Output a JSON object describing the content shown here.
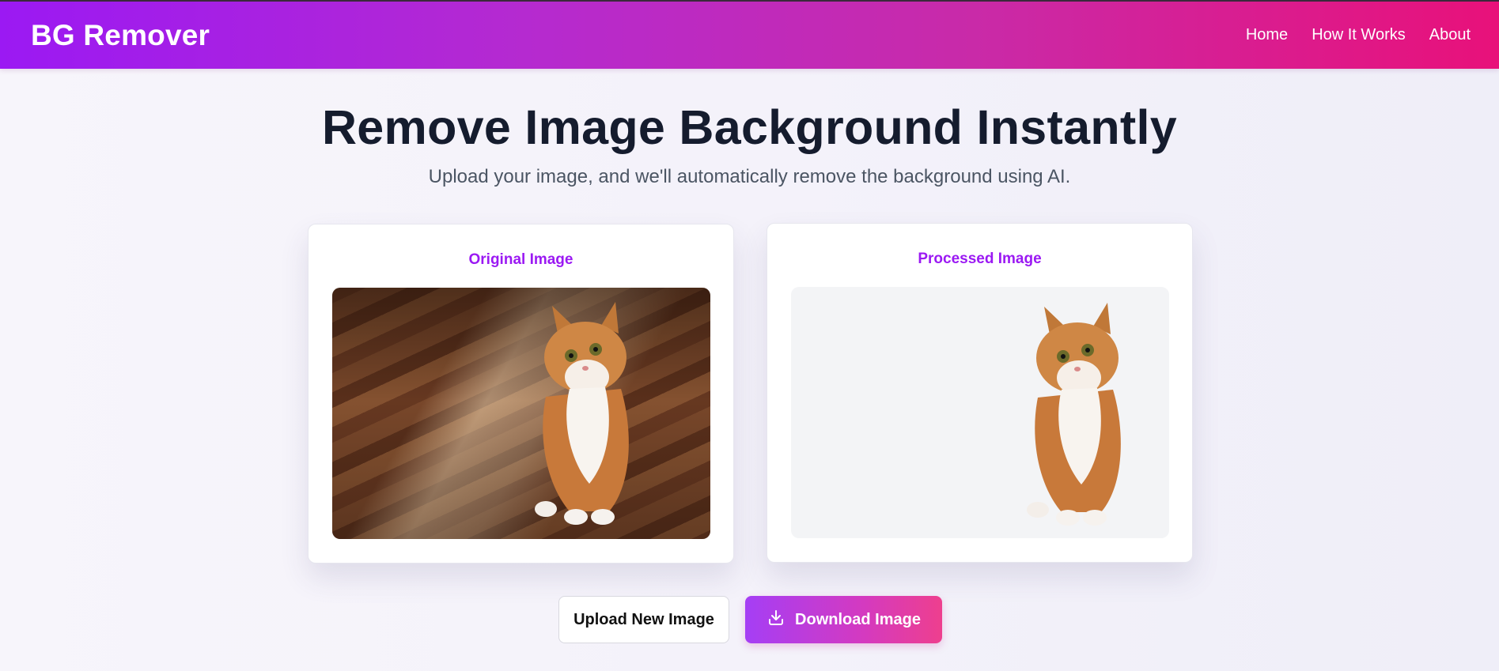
{
  "header": {
    "logo": "BG Remover",
    "nav": [
      "Home",
      "How It Works",
      "About"
    ]
  },
  "hero": {
    "title": "Remove Image Background Instantly",
    "subtitle": "Upload your image, and we'll automatically remove the background using AI."
  },
  "cards": {
    "original": {
      "title": "Original Image"
    },
    "processed": {
      "title": "Processed Image"
    }
  },
  "buttons": {
    "upload": "Upload New Image",
    "download": "Download Image",
    "download_icon": "download-icon"
  },
  "colors": {
    "brand_purple": "#9b19f3",
    "brand_pink": "#e8117a",
    "heading": "#151c2e"
  }
}
